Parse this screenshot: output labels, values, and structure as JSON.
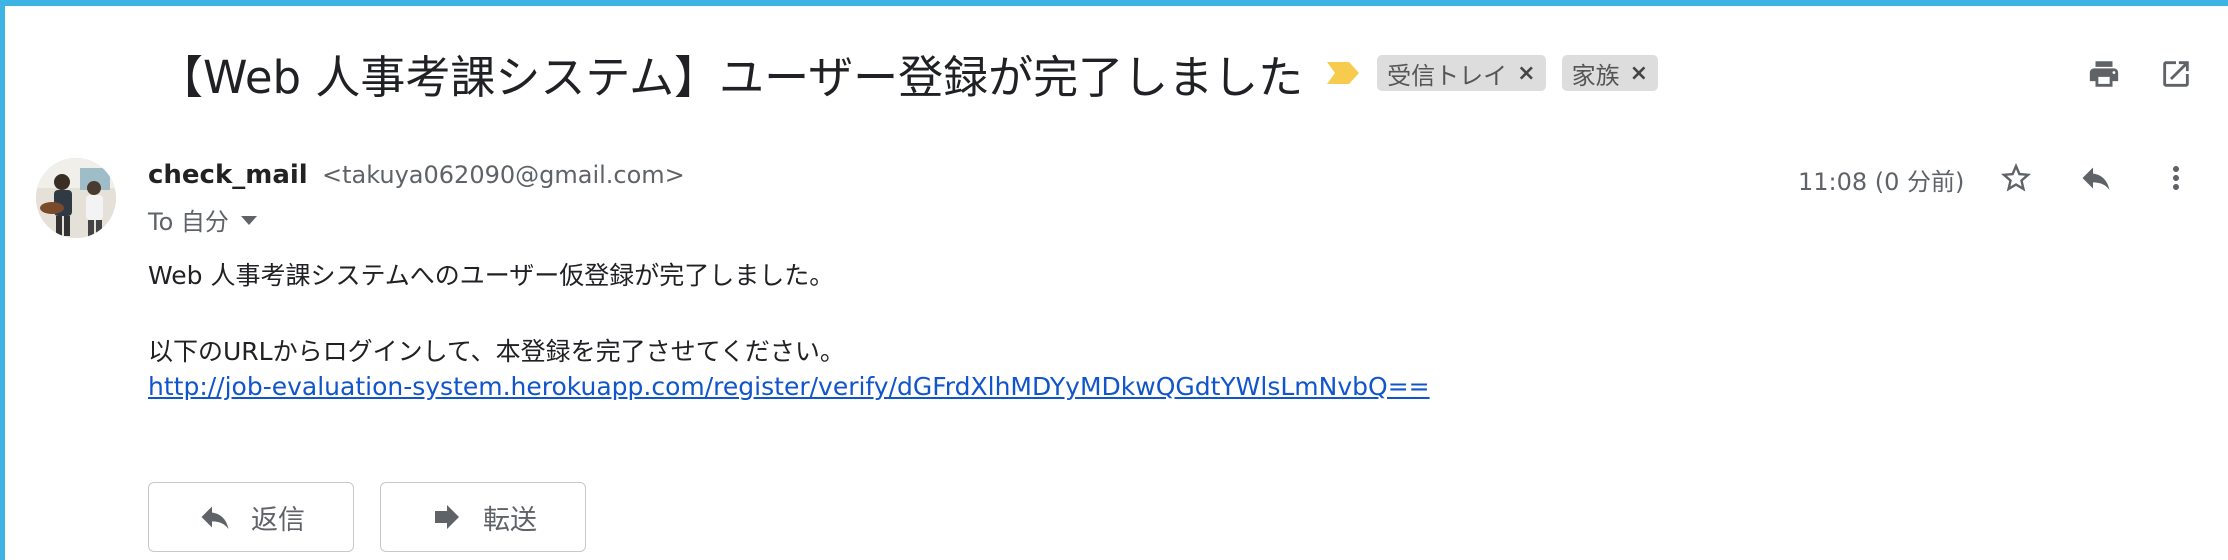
{
  "email": {
    "subject": "【Web 人事考課システム】ユーザー登録が完了しました",
    "labels": [
      {
        "name": "受信トレイ"
      },
      {
        "name": "家族"
      }
    ],
    "label_remove_glyph": "×",
    "sender": {
      "name": "check_mail",
      "email": "<takuya062090@gmail.com>"
    },
    "to_text": "To 自分",
    "time": "11:08 (0 分前)",
    "body": {
      "line1": "Web 人事考課システムへのユーザー仮登録が完了しました。",
      "line2": "以下のURLからログインして、本登録を完了させてください。",
      "link": "http://job-evaluation-system.herokuapp.com/register/verify/dGFrdXlhMDYyMDkwQGdtYWlsLmNvbQ=="
    }
  },
  "actions": {
    "reply_label": "返信",
    "forward_label": "転送"
  },
  "icons": {
    "importance": "importance-marker-icon",
    "print": "print-icon",
    "open_new_window": "open-in-new-window-icon",
    "star": "star-icon",
    "reply": "reply-icon",
    "more": "more-vertical-icon"
  },
  "colors": {
    "frame_accent": "#3eb4e4",
    "importance_marker": "#f7cb4d",
    "link": "#1155cc",
    "label_chip_bg": "#dddddd"
  }
}
